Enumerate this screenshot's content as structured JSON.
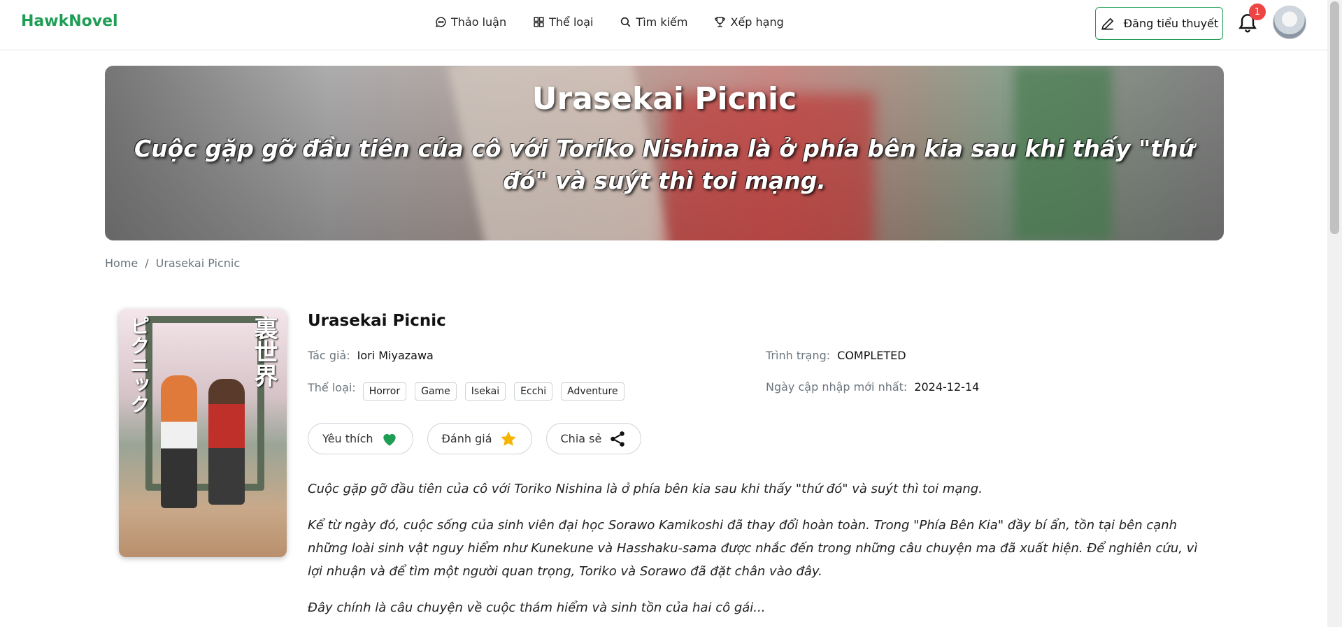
{
  "header": {
    "logo": "HawkNovel",
    "nav": [
      {
        "label": "Thảo luận",
        "icon": "chat-bubble-icon"
      },
      {
        "label": "Thể loại",
        "icon": "grid-icon"
      },
      {
        "label": "Tìm kiếm",
        "icon": "search-icon"
      },
      {
        "label": "Xếp hạng",
        "icon": "trophy-icon"
      }
    ],
    "post_button": "Đăng tiểu thuyết",
    "notification_count": "1"
  },
  "banner": {
    "title": "Urasekai Picnic",
    "subtitle": "Cuộc gặp gỡ đầu tiên của cô với Toriko Nishina là ở phía bên kia sau khi thấy \"thứ đó\" và suýt thì toi mạng."
  },
  "breadcrumb": {
    "home": "Home",
    "separator": "/",
    "current": "Urasekai Picnic"
  },
  "cover": {
    "kanji": "裏世界",
    "kana": "ピクニック"
  },
  "novel": {
    "title": "Urasekai Picnic",
    "author_label": "Tác giả:",
    "author": "Iori Miyazawa",
    "status_label": "Trình trạng:",
    "status": "COMPLETED",
    "genre_label": "Thể loại:",
    "genres": [
      "Horror",
      "Game",
      "Isekai",
      "Ecchi",
      "Adventure"
    ],
    "updated_label": "Ngày cập nhập mới nhất:",
    "updated": "2024-12-14"
  },
  "actions": {
    "favorite": "Yêu thích",
    "rate": "Đánh giá",
    "share": "Chia sẻ"
  },
  "description": [
    "Cuộc gặp gỡ đầu tiên của cô với Toriko Nishina là ở phía bên kia sau khi thấy \"thứ đó\" và suýt thì toi mạng.",
    "Kể từ ngày đó, cuộc sống của sinh viên đại học Sorawo Kamikoshi đã thay đổi hoàn toàn. Trong \"Phía Bên Kia\" đầy bí ẩn, tồn tại bên cạnh những loài sinh vật nguy hiểm như Kunekune và Hasshaku-sama được nhắc đến trong những câu chuyện ma đã xuất hiện. Để nghiên cứu, vì lợi nhuận và để tìm một người quan trọng, Toriko và Sorawo đã đặt chân vào đây.",
    "Đây chính là câu chuyện về cuộc thám hiểm và sinh tồn của hai cô gái..."
  ],
  "colors": {
    "brand": "#1f9d55",
    "badge": "#ef4444",
    "star": "#f4b400"
  }
}
